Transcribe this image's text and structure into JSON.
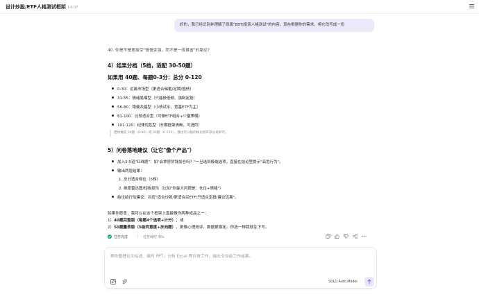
{
  "header": {
    "title": "设计炒股/ETF人格测试框架",
    "timestamp": "昨天 14:07"
  },
  "user_message": "好的，我已经识别并理解了原版\"EBTI投资人格测试\"的内容，现在根据你的需求，将它改写成一份",
  "assistant": {
    "q40": "40. 你是不是更接受\"慢慢变强，而不是一夜暴富\"的路径?",
    "section4": {
      "heading": "4）结果分档（5档，适配 30-50题）",
      "subheading": "如果用 40题、每题0-3分：总分 0-120",
      "items": [
        "0-30：远离市场型（更适合储蓄/定期/国债）",
        "31-55：情绪易爆型（只能极低频、强制定投）",
        "56-80：稳健及格型（小核试水、宽基ETF为主）",
        "81-100：比较适合型（可做ETF组合+少量策略）",
        "101-120：纪律优胜型（长期框架清晰，可进阶）"
      ],
      "note": "若你做成 30题（0-90）或 50题（0-150），我也可以按同样比例平移分段即可。"
    },
    "section5": {
      "heading": "5）问卷落地建议（让它\"像个产品\"）",
      "item1": "加入3-5道\"红线题\"：如\"会拿房贷钱加仓吗？\"一旦选到极端选项，直接在结论里提示\"高危行为\"。",
      "item2": "输出两层结果：",
      "sub1": "1. 总分适合档位（5档）",
      "sub2": "2. 维度雷达图/短板提示（比如\"你最大问题是：仓位+情绪\"）",
      "item3": "结论给行动建议：对应\"适合炒股/更适合买ETF/只适合定投/建议远离\"。"
    },
    "closing": {
      "intro": "如果你愿意，我可以在这个框架上直接做你两种成品之一：",
      "opt1_prefix": "1）",
      "opt1_bold": "40题完整版（每题4个选项+计分）",
      "opt1_rest": "；或",
      "opt2_prefix": "2）",
      "opt2_bold": "50题量表版（5级同意度+反向题）",
      "opt2_rest": "，更像心理测评，数据更稳定。你选一种我就往下写。"
    },
    "status": {
      "label": "任务完成",
      "separator": "|",
      "time": "任务耗时 46s"
    }
  },
  "composer": {
    "placeholder": "帮你整理论文综述、编写 PPT、分析 Excel 等日常工作，输出专业级工作成果。",
    "model": "SOLO Auto Model"
  },
  "icons": {
    "menu": "hamburger-icon",
    "check": "check-circle-icon",
    "copy": "copy-icon",
    "like": "thumbs-up-icon",
    "dislike": "thumbs-down-icon",
    "share": "share-icon",
    "more": "more-icon",
    "edit": "edit-icon",
    "attach": "attach-icon",
    "send": "arrow-up-icon"
  },
  "colors": {
    "accent": "#7c6cf0",
    "bubble": "#ece9fb",
    "success": "#1aa76b"
  }
}
